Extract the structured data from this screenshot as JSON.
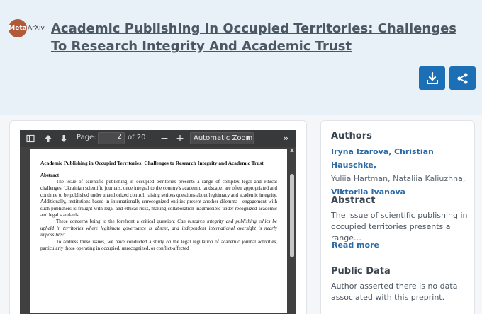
{
  "logo": {
    "meta": "Meta",
    "arxiv": "ArXiv"
  },
  "title": "Academic Publishing In Occupied Territories: Challenges To Research Integrity And Academic Trust",
  "header_buttons": {
    "download_icon": "download-icon",
    "share_icon": "share-icon"
  },
  "colors": {
    "accent": "#1c6fb5",
    "link": "#2a6aa5",
    "header_bg": "#e8f0f8"
  },
  "viewer": {
    "page_label": "Page:",
    "page_value": "2",
    "page_of": "of 20",
    "zoom_minus": "−",
    "zoom_plus": "+",
    "zoom_value": "Automatic Zoom",
    "more": "»"
  },
  "pdf": {
    "title": "Academic Publishing in Occupied Territories: Challenges to Research Integrity and Academic Trust",
    "abstract_heading": "Abstract",
    "p1": "The issue of scientific publishing in occupied territories presents a range of complex legal and ethical challenges. Ukrainian scientific journals, once integral to the country's academic landscape, are often appropriated and continue to be published under unauthorized control, raising serious questions about legitimacy and academic integrity. Additionally, institutions based in internationally unrecognized entities present another dilemma—engagement with such publishers is fraught with legal and ethical risks, making collaboration inadmissible under recognized academic and legal standards.",
    "p2_start": "These concerns bring to the forefront a critical question: ",
    "p2_italic": "Can research integrity and publishing ethics be upheld in territories where legitimate governance is absent, and independent international oversight is nearly impossible?",
    "p3": "To address these issues, we have conducted a study on the legal regulation of academic journal activities, particularly those operating in occupied, unrecognized, or conflict-affected"
  },
  "sidebar": {
    "authors_heading": "Authors",
    "author1": "Iryna Izarova,",
    "author2": "Christian Hauschke,",
    "author3": "Yuliia Hartman,",
    "author4": "Nataliia Kaliuzhna,",
    "author5": "Viktoriia Ivanova",
    "abstract_heading": "Abstract",
    "abstract_text": "The issue of scientific publishing in occupied territories presents a range…",
    "read_more": "Read more",
    "public_data_heading": "Public Data",
    "public_data_text": "Author asserted there is no data associated with this preprint."
  }
}
